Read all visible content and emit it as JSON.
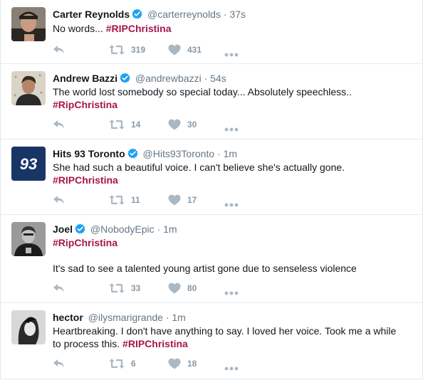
{
  "tweets": [
    {
      "name": "Carter Reynolds",
      "handle": "@carterreynolds",
      "sep": "·",
      "time": "37s",
      "text": "No words...",
      "hashtag": "#RIPChristina",
      "retweets": "319",
      "likes": "431"
    },
    {
      "name": "Andrew Bazzi",
      "handle": "@andrewbazzi",
      "sep": "·",
      "time": "54s",
      "text": "The world lost somebody so special today... Absolutely speechless..",
      "hashtag": "#RipChristina",
      "retweets": "14",
      "likes": "30"
    },
    {
      "name": "Hits 93 Toronto",
      "handle": "@Hits93Toronto",
      "sep": "·",
      "time": "1m",
      "avatar_text": "93",
      "text": "She had such a beautiful voice. I can't believe she's actually gone.",
      "hashtag": "#RIPChristina",
      "retweets": "11",
      "likes": "17"
    },
    {
      "name": "Joel",
      "handle": "@NobodyEpic",
      "sep": "·",
      "time": "1m",
      "hashtag": "#RipChristina",
      "text": "It's sad to see a talented young artist gone due to senseless violence",
      "retweets": "33",
      "likes": "80"
    },
    {
      "name": "hector",
      "handle": "@ilysmarigrande",
      "sep": "·",
      "time": "1m",
      "text_line1": "Heartbreaking. I don't have anything to say. I loved her voice. Took me a while",
      "text_line2": "to process this.",
      "hashtag": "#RIPChristina",
      "retweets": "6",
      "likes": "18"
    }
  ],
  "icons": {
    "reply": "reply-icon",
    "retweet": "retweet-icon",
    "like": "heart-icon",
    "more": "more-icon",
    "verified": "verified-badge-icon"
  },
  "colors": {
    "hashtag": "#a5164b",
    "verified": "#1da1f2",
    "muted": "#8899a6",
    "handle": "#657786"
  }
}
